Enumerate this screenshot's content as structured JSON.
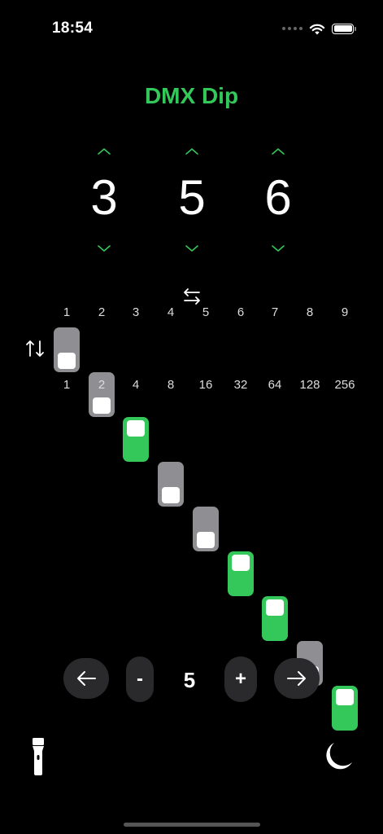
{
  "status_bar": {
    "time": "18:54"
  },
  "title": "DMX Dip",
  "digits": [
    "3",
    "5",
    "6"
  ],
  "dip": {
    "top_labels": [
      "1",
      "2",
      "3",
      "4",
      "5",
      "6",
      "7",
      "8",
      "9"
    ],
    "bottom_labels": [
      "1",
      "2",
      "4",
      "8",
      "16",
      "32",
      "64",
      "128",
      "256"
    ],
    "states": [
      false,
      false,
      true,
      false,
      false,
      true,
      true,
      false,
      true
    ]
  },
  "stepper": {
    "prev_icon": "arrow-left-icon",
    "minus_label": "-",
    "value": "5",
    "plus_label": "+",
    "next_icon": "arrow-right-icon"
  },
  "toolbar": {
    "left_icon": "flashlight-icon",
    "right_icon": "moon-icon"
  },
  "colors": {
    "accent": "#34c759",
    "switch_off": "#8e8e93",
    "button_bg": "#2a2a2c"
  }
}
